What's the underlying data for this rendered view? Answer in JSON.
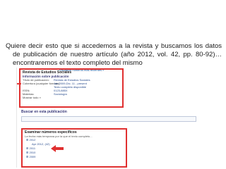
{
  "slide": {
    "text": "Quiere decir esto que si accedemos a la revista y buscamos los datos de publicación de nuestro artículo (año 2012, vol. 42, pp. 80-92)…encontraremos el texto completo del mismo"
  },
  "screenshot": {
    "journal_title": "Revista de Estudios Sociales",
    "info_heading": "Información sobre publicación",
    "top_right_link": "Visualizar números más recientes »",
    "rows": [
      {
        "k": "Título de publicación:",
        "v": "Revista de Estudios Sociales"
      },
      {
        "k": "Cobertura (cualquier formato):",
        "v": "Jan 2009-Dic. 11 - present"
      },
      {
        "k": "",
        "v": "Texto completo disponible"
      },
      {
        "k": "ISSN:",
        "v": "0123-885X"
      },
      {
        "k": "Materias:",
        "v": "Sociología"
      },
      {
        "k": "Mostrar todo »",
        "v": ""
      }
    ],
    "search_label": "Buscar en esta publicación",
    "issues_heading": "Examinar números específicos",
    "issues_note": "La fecha más temprana por la que el texto completo...",
    "issues": [
      "2012",
      "Apr 2012, (42)",
      "2011",
      "2010",
      "2009"
    ],
    "accent_color": "#e03030"
  }
}
